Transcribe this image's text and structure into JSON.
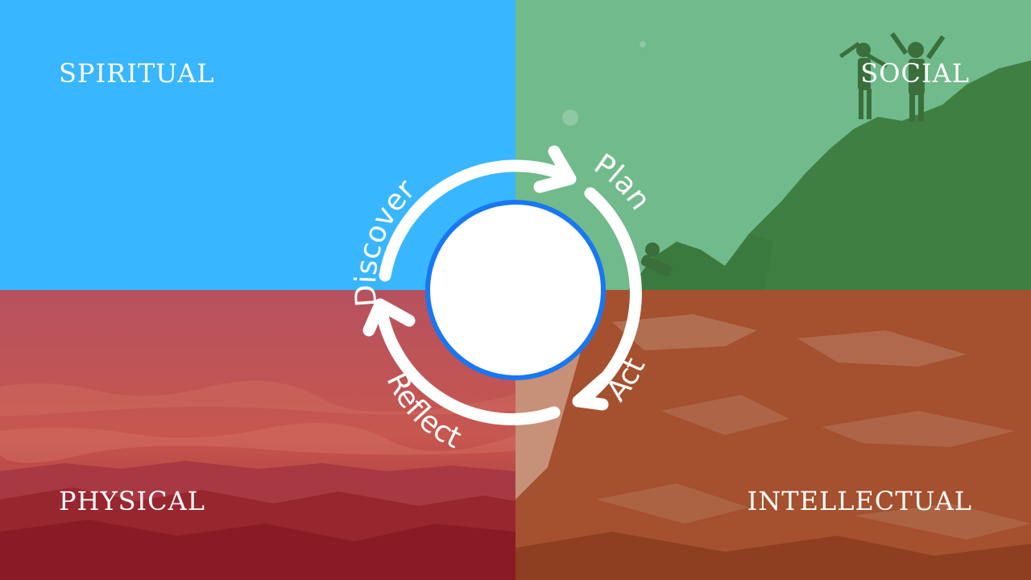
{
  "quadrants": {
    "spiritual": {
      "label": "SPIRITUAL",
      "color": "#38B6FF"
    },
    "social": {
      "label": "SOCIAL",
      "color": "#6FB98A"
    },
    "physical": {
      "label": "PHYSICAL",
      "color": "#B33845"
    },
    "intellectual": {
      "label": "INTELLECTUAL",
      "color": "#A5502E"
    }
  },
  "cycle": {
    "steps": [
      "Discover",
      "Plan",
      "Act",
      "Reflect"
    ],
    "ring_color": "#1877F2",
    "center_color": "#FFFFFF",
    "arrow_color": "#FFFFFF"
  }
}
